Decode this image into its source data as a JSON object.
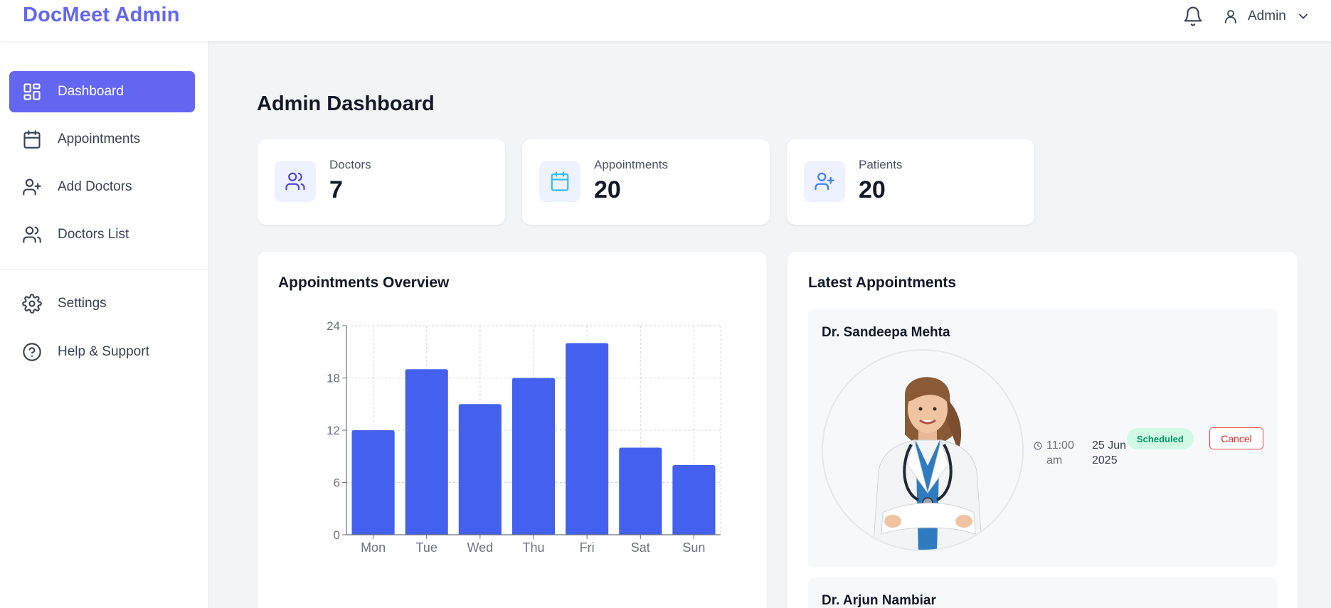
{
  "header": {
    "brand": "DocMeet Admin",
    "user_label": "Admin",
    "icons": {
      "notifications": "bell-icon",
      "user": "user-icon",
      "menu": "chevron-down-icon"
    }
  },
  "sidebar": {
    "items": [
      {
        "label": "Dashboard",
        "icon": "dashboard-icon",
        "active": true
      },
      {
        "label": "Appointments",
        "icon": "calendar-icon",
        "active": false
      },
      {
        "label": "Add Doctors",
        "icon": "user-plus-icon",
        "active": false
      },
      {
        "label": "Doctors List",
        "icon": "users-icon",
        "active": false
      },
      {
        "label": "Settings",
        "icon": "gear-icon",
        "active": false
      },
      {
        "label": "Help & Support",
        "icon": "help-circle-icon",
        "active": false
      }
    ]
  },
  "main": {
    "title": "Admin Dashboard",
    "stats": [
      {
        "label": "Doctors",
        "value": "7",
        "icon": "users-icon",
        "color": "#4f46e5"
      },
      {
        "label": "Appointments",
        "value": "20",
        "icon": "calendar-icon",
        "color": "#38bdf8"
      },
      {
        "label": "Patients",
        "value": "20",
        "icon": "user-plus-icon",
        "color": "#3b82f6"
      }
    ],
    "overview": {
      "title": "Appointments Overview"
    },
    "latest": {
      "title": "Latest Appointments",
      "appointments": [
        {
          "doctor": "Dr. Sandeepa Mehta",
          "time": "11:00 am",
          "date": "25 Jun 2025",
          "status": "Scheduled",
          "action": "Cancel"
        },
        {
          "doctor": "Dr. Arjun Nambiar"
        }
      ]
    }
  },
  "colors": {
    "accent": "#6366f1",
    "bar": "#4361ee",
    "status_scheduled_bg": "#d1fae5",
    "status_scheduled_text": "#059669",
    "danger": "#ef4444"
  },
  "chart_data": {
    "type": "bar",
    "categories": [
      "Mon",
      "Tue",
      "Wed",
      "Thu",
      "Fri",
      "Sat",
      "Sun"
    ],
    "values": [
      12,
      19,
      15,
      18,
      22,
      10,
      8
    ],
    "yticks": [
      0,
      6,
      12,
      18,
      24
    ],
    "ylim": [
      0,
      24
    ],
    "grid": true,
    "title": "",
    "xlabel": "",
    "ylabel": ""
  }
}
